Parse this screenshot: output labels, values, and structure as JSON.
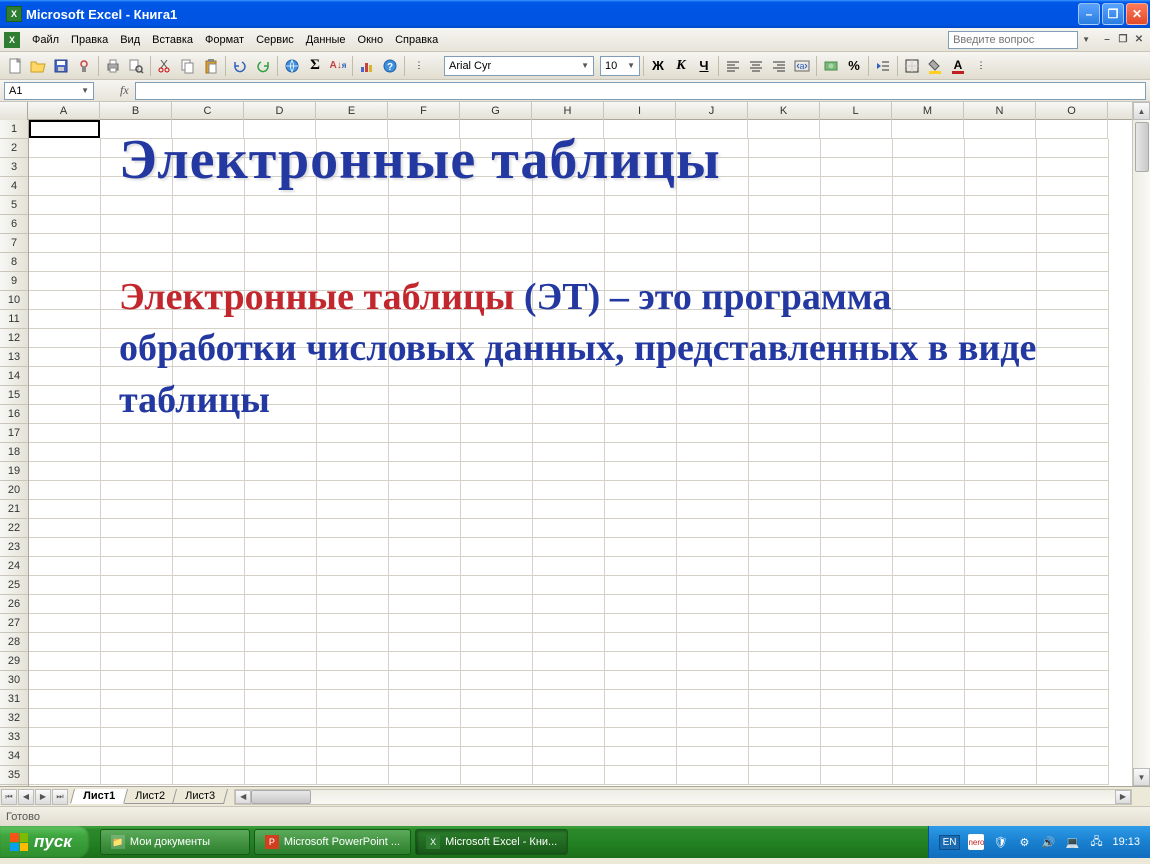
{
  "titlebar": {
    "title": "Microsoft Excel - Книга1"
  },
  "menubar": {
    "items": [
      "Файл",
      "Правка",
      "Вид",
      "Вставка",
      "Формат",
      "Сервис",
      "Данные",
      "Окно",
      "Справка"
    ],
    "help_placeholder": "Введите вопрос"
  },
  "toolbar": {
    "font_name": "Arial Cyr",
    "font_size": "10",
    "bold": "Ж",
    "italic": "К",
    "underline": "Ч",
    "percent": "%"
  },
  "formula_bar": {
    "name_box": "A1",
    "fx": "fx",
    "formula": ""
  },
  "columns": [
    "A",
    "B",
    "C",
    "D",
    "E",
    "F",
    "G",
    "H",
    "I",
    "J",
    "K",
    "L",
    "M",
    "N",
    "O"
  ],
  "rows": [
    "1",
    "2",
    "3",
    "4",
    "5",
    "6",
    "7",
    "8",
    "9",
    "10",
    "11",
    "12",
    "13",
    "14",
    "15",
    "16",
    "17",
    "18",
    "19",
    "20",
    "21",
    "22",
    "23",
    "24",
    "25",
    "26",
    "27",
    "28",
    "29",
    "30",
    "31",
    "32",
    "33",
    "34",
    "35"
  ],
  "overlay": {
    "title": "Электронные таблицы",
    "body_red": "Электронные таблицы",
    "body_rest": " (ЭТ) – это программа обработки числовых данных, представленных в виде таблицы"
  },
  "sheet_tabs": [
    "Лист1",
    "Лист2",
    "Лист3"
  ],
  "statusbar": {
    "ready": "Готово"
  },
  "taskbar": {
    "start": "пуск",
    "items": [
      {
        "label": "Мои документы"
      },
      {
        "label": "Microsoft PowerPoint ..."
      },
      {
        "label": "Microsoft Excel - Кни..."
      }
    ],
    "lang": "EN",
    "nero": "nero",
    "clock": "19:13"
  }
}
